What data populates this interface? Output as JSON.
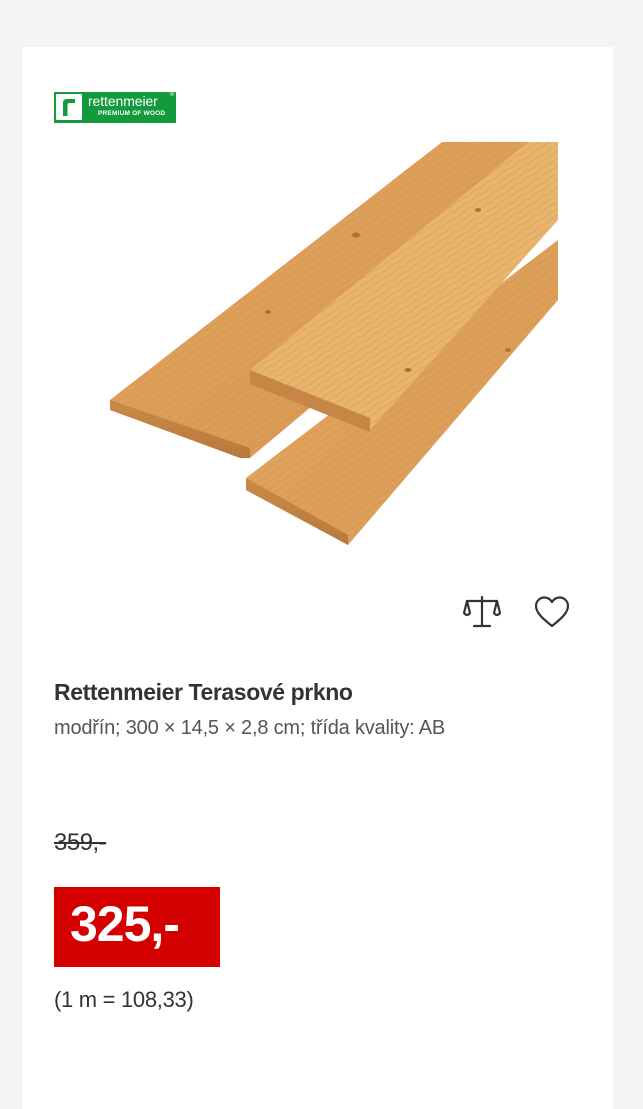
{
  "brand": {
    "logo_name": "rettenmeier",
    "logo_tagline": "PREMIUM OF WOOD",
    "logo_reg": "®",
    "logo_color": "#129a3b"
  },
  "product": {
    "image_icon": "wood-planks-image",
    "title": "Rettenmeier Terasové prkno",
    "subtitle": "modřín; 300 × 14,5 × 2,8 cm; třída kvality: AB"
  },
  "actions": {
    "compare_icon": "compare-scale-icon",
    "wishlist_icon": "heart-icon"
  },
  "pricing": {
    "old_price": "359,-",
    "current_price": "325,-",
    "unit_price": "(1 m = 108,33)",
    "price_badge_color": "#d40000"
  }
}
